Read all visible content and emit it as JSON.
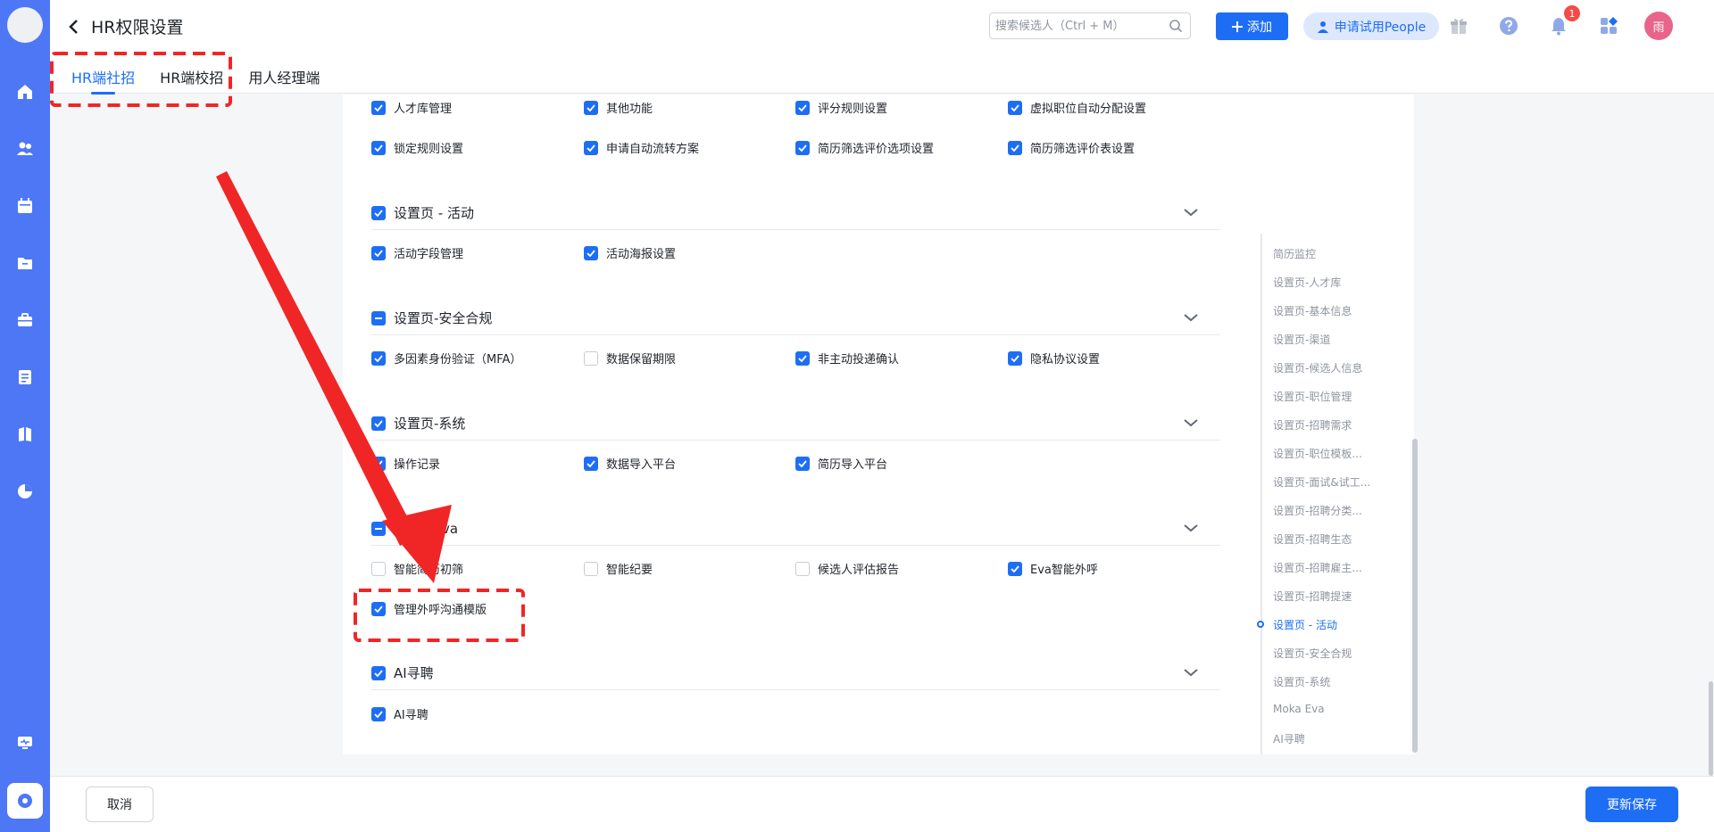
{
  "header": {
    "title": "HR权限设置",
    "search_placeholder": "搜索候选人（Ctrl + M）",
    "add_label": "添加",
    "trial_label": "申请试用People",
    "notification_count": "1",
    "avatar_text": "雨"
  },
  "tabs": [
    {
      "label": "HR端社招",
      "active": true
    },
    {
      "label": "HR端校招",
      "active": false
    },
    {
      "label": "用人经理端",
      "active": false
    }
  ],
  "sections": {
    "top": {
      "items": [
        {
          "label": "人才库管理",
          "checked": true
        },
        {
          "label": "其他功能",
          "checked": true
        },
        {
          "label": "评分规则设置",
          "checked": true
        },
        {
          "label": "虚拟职位自动分配设置",
          "checked": true
        },
        {
          "label": "锁定规则设置",
          "checked": true
        },
        {
          "label": "申请自动流转方案",
          "checked": true
        },
        {
          "label": "简历筛选评价选项设置",
          "checked": true
        },
        {
          "label": "简历筛选评价表设置",
          "checked": true
        }
      ]
    },
    "activity": {
      "title": "设置页 - 活动",
      "state": "checked",
      "items": [
        {
          "label": "活动字段管理",
          "checked": true
        },
        {
          "label": "活动海报设置",
          "checked": true
        }
      ]
    },
    "security": {
      "title": "设置页-安全合规",
      "state": "partial",
      "items": [
        {
          "label": "多因素身份验证（MFA）",
          "checked": true
        },
        {
          "label": "数据保留期限",
          "checked": false
        },
        {
          "label": "非主动投递确认",
          "checked": true
        },
        {
          "label": "隐私协议设置",
          "checked": true
        }
      ]
    },
    "system": {
      "title": "设置页-系统",
      "state": "checked",
      "items": [
        {
          "label": "操作记录",
          "checked": true
        },
        {
          "label": "数据导入平台",
          "checked": true
        },
        {
          "label": "简历导入平台",
          "checked": true
        }
      ]
    },
    "eva": {
      "title": "Moka Eva",
      "state": "partial",
      "items": [
        {
          "label": "智能简历初筛",
          "checked": false
        },
        {
          "label": "智能纪要",
          "checked": false
        },
        {
          "label": "候选人评估报告",
          "checked": false
        },
        {
          "label": "Eva智能外呼",
          "checked": true
        },
        {
          "label": "管理外呼沟通模版",
          "checked": true
        }
      ]
    },
    "ai": {
      "title": "AI寻聘",
      "state": "checked",
      "items": [
        {
          "label": "AI寻聘",
          "checked": true
        }
      ]
    }
  },
  "anchor_nav": {
    "items": [
      "简历监控",
      "设置页-人才库",
      "设置页-基本信息",
      "设置页-渠道",
      "设置页-候选人信息",
      "设置页-职位管理",
      "设置页-招聘需求",
      "设置页-职位模板...",
      "设置页-面试&试工...",
      "设置页-招聘分类...",
      "设置页-招聘生态",
      "设置页-招聘雇主...",
      "设置页-招聘提速",
      "设置页 - 活动",
      "设置页-安全合规",
      "设置页-系统",
      "Moka Eva",
      "AI寻聘"
    ],
    "active_index": 13
  },
  "footer": {
    "cancel_label": "取消",
    "save_label": "更新保存"
  },
  "colors": {
    "accent": "#1e6ef5",
    "nav_bg": "#4e77f5",
    "annotation_red": "#f02626"
  }
}
